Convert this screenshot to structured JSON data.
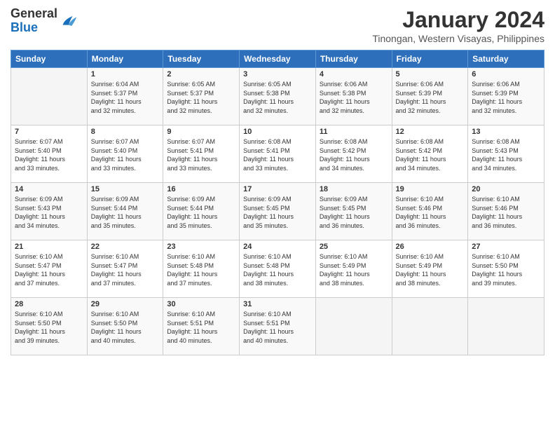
{
  "header": {
    "logo_general": "General",
    "logo_blue": "Blue",
    "month_title": "January 2024",
    "subtitle": "Tinongan, Western Visayas, Philippines"
  },
  "days_of_week": [
    "Sunday",
    "Monday",
    "Tuesday",
    "Wednesday",
    "Thursday",
    "Friday",
    "Saturday"
  ],
  "weeks": [
    [
      {
        "day": "",
        "sunrise": "",
        "sunset": "",
        "daylight": ""
      },
      {
        "day": "1",
        "sunrise": "Sunrise: 6:04 AM",
        "sunset": "Sunset: 5:37 PM",
        "daylight": "Daylight: 11 hours and 32 minutes."
      },
      {
        "day": "2",
        "sunrise": "Sunrise: 6:05 AM",
        "sunset": "Sunset: 5:37 PM",
        "daylight": "Daylight: 11 hours and 32 minutes."
      },
      {
        "day": "3",
        "sunrise": "Sunrise: 6:05 AM",
        "sunset": "Sunset: 5:38 PM",
        "daylight": "Daylight: 11 hours and 32 minutes."
      },
      {
        "day": "4",
        "sunrise": "Sunrise: 6:06 AM",
        "sunset": "Sunset: 5:38 PM",
        "daylight": "Daylight: 11 hours and 32 minutes."
      },
      {
        "day": "5",
        "sunrise": "Sunrise: 6:06 AM",
        "sunset": "Sunset: 5:39 PM",
        "daylight": "Daylight: 11 hours and 32 minutes."
      },
      {
        "day": "6",
        "sunrise": "Sunrise: 6:06 AM",
        "sunset": "Sunset: 5:39 PM",
        "daylight": "Daylight: 11 hours and 32 minutes."
      }
    ],
    [
      {
        "day": "7",
        "sunrise": "Sunrise: 6:07 AM",
        "sunset": "Sunset: 5:40 PM",
        "daylight": "Daylight: 11 hours and 33 minutes."
      },
      {
        "day": "8",
        "sunrise": "Sunrise: 6:07 AM",
        "sunset": "Sunset: 5:40 PM",
        "daylight": "Daylight: 11 hours and 33 minutes."
      },
      {
        "day": "9",
        "sunrise": "Sunrise: 6:07 AM",
        "sunset": "Sunset: 5:41 PM",
        "daylight": "Daylight: 11 hours and 33 minutes."
      },
      {
        "day": "10",
        "sunrise": "Sunrise: 6:08 AM",
        "sunset": "Sunset: 5:41 PM",
        "daylight": "Daylight: 11 hours and 33 minutes."
      },
      {
        "day": "11",
        "sunrise": "Sunrise: 6:08 AM",
        "sunset": "Sunset: 5:42 PM",
        "daylight": "Daylight: 11 hours and 34 minutes."
      },
      {
        "day": "12",
        "sunrise": "Sunrise: 6:08 AM",
        "sunset": "Sunset: 5:42 PM",
        "daylight": "Daylight: 11 hours and 34 minutes."
      },
      {
        "day": "13",
        "sunrise": "Sunrise: 6:08 AM",
        "sunset": "Sunset: 5:43 PM",
        "daylight": "Daylight: 11 hours and 34 minutes."
      }
    ],
    [
      {
        "day": "14",
        "sunrise": "Sunrise: 6:09 AM",
        "sunset": "Sunset: 5:43 PM",
        "daylight": "Daylight: 11 hours and 34 minutes."
      },
      {
        "day": "15",
        "sunrise": "Sunrise: 6:09 AM",
        "sunset": "Sunset: 5:44 PM",
        "daylight": "Daylight: 11 hours and 35 minutes."
      },
      {
        "day": "16",
        "sunrise": "Sunrise: 6:09 AM",
        "sunset": "Sunset: 5:44 PM",
        "daylight": "Daylight: 11 hours and 35 minutes."
      },
      {
        "day": "17",
        "sunrise": "Sunrise: 6:09 AM",
        "sunset": "Sunset: 5:45 PM",
        "daylight": "Daylight: 11 hours and 35 minutes."
      },
      {
        "day": "18",
        "sunrise": "Sunrise: 6:09 AM",
        "sunset": "Sunset: 5:45 PM",
        "daylight": "Daylight: 11 hours and 36 minutes."
      },
      {
        "day": "19",
        "sunrise": "Sunrise: 6:10 AM",
        "sunset": "Sunset: 5:46 PM",
        "daylight": "Daylight: 11 hours and 36 minutes."
      },
      {
        "day": "20",
        "sunrise": "Sunrise: 6:10 AM",
        "sunset": "Sunset: 5:46 PM",
        "daylight": "Daylight: 11 hours and 36 minutes."
      }
    ],
    [
      {
        "day": "21",
        "sunrise": "Sunrise: 6:10 AM",
        "sunset": "Sunset: 5:47 PM",
        "daylight": "Daylight: 11 hours and 37 minutes."
      },
      {
        "day": "22",
        "sunrise": "Sunrise: 6:10 AM",
        "sunset": "Sunset: 5:47 PM",
        "daylight": "Daylight: 11 hours and 37 minutes."
      },
      {
        "day": "23",
        "sunrise": "Sunrise: 6:10 AM",
        "sunset": "Sunset: 5:48 PM",
        "daylight": "Daylight: 11 hours and 37 minutes."
      },
      {
        "day": "24",
        "sunrise": "Sunrise: 6:10 AM",
        "sunset": "Sunset: 5:48 PM",
        "daylight": "Daylight: 11 hours and 38 minutes."
      },
      {
        "day": "25",
        "sunrise": "Sunrise: 6:10 AM",
        "sunset": "Sunset: 5:49 PM",
        "daylight": "Daylight: 11 hours and 38 minutes."
      },
      {
        "day": "26",
        "sunrise": "Sunrise: 6:10 AM",
        "sunset": "Sunset: 5:49 PM",
        "daylight": "Daylight: 11 hours and 38 minutes."
      },
      {
        "day": "27",
        "sunrise": "Sunrise: 6:10 AM",
        "sunset": "Sunset: 5:50 PM",
        "daylight": "Daylight: 11 hours and 39 minutes."
      }
    ],
    [
      {
        "day": "28",
        "sunrise": "Sunrise: 6:10 AM",
        "sunset": "Sunset: 5:50 PM",
        "daylight": "Daylight: 11 hours and 39 minutes."
      },
      {
        "day": "29",
        "sunrise": "Sunrise: 6:10 AM",
        "sunset": "Sunset: 5:50 PM",
        "daylight": "Daylight: 11 hours and 40 minutes."
      },
      {
        "day": "30",
        "sunrise": "Sunrise: 6:10 AM",
        "sunset": "Sunset: 5:51 PM",
        "daylight": "Daylight: 11 hours and 40 minutes."
      },
      {
        "day": "31",
        "sunrise": "Sunrise: 6:10 AM",
        "sunset": "Sunset: 5:51 PM",
        "daylight": "Daylight: 11 hours and 40 minutes."
      },
      {
        "day": "",
        "sunrise": "",
        "sunset": "",
        "daylight": ""
      },
      {
        "day": "",
        "sunrise": "",
        "sunset": "",
        "daylight": ""
      },
      {
        "day": "",
        "sunrise": "",
        "sunset": "",
        "daylight": ""
      }
    ]
  ]
}
